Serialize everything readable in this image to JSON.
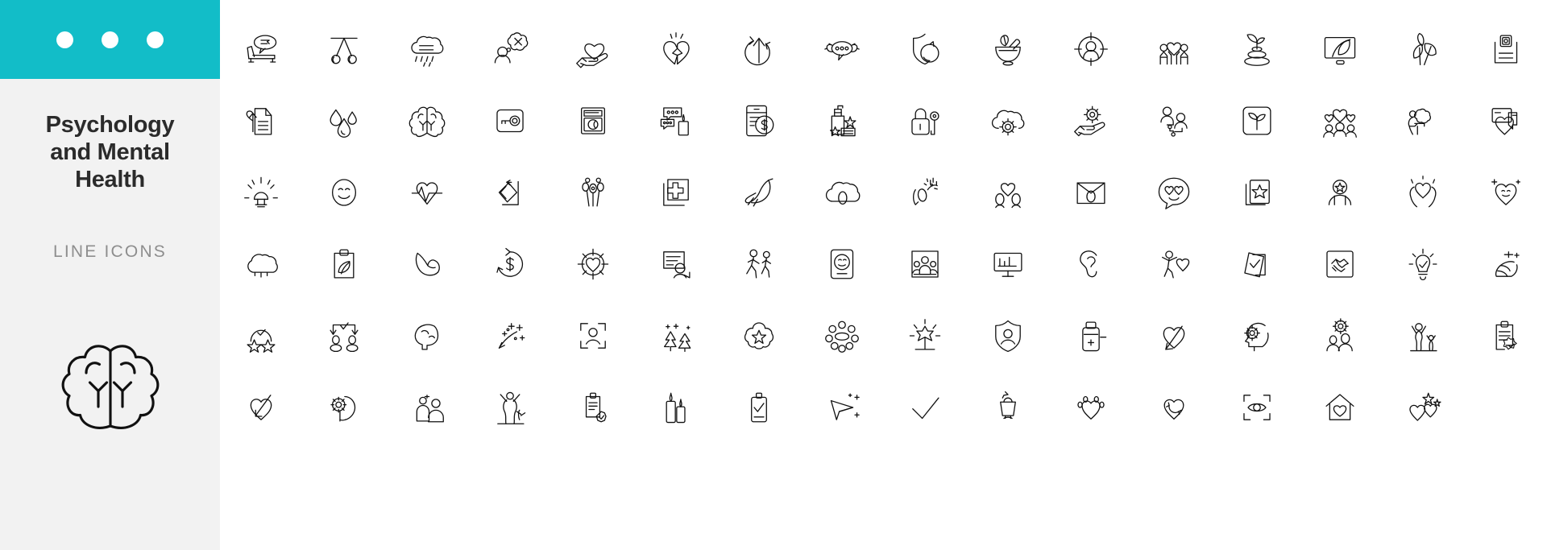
{
  "sidebar": {
    "title": "Psychology and Mental Health",
    "subtitle": "LINE ICONS",
    "accent_color": "#12bdc8",
    "background_color": "#f2f2f2",
    "topbar_dots": [
      "dot-1",
      "dot-2",
      "dot-3"
    ],
    "logo_icon": "brain-icon"
  },
  "grid": {
    "columns": 16,
    "rows": 6,
    "stroke_color": "#111111",
    "background_color": "#ffffff",
    "icons": [
      "therapy-couch-speech-bubble-icon",
      "pendulum-hypnosis-icon",
      "rain-cloud-icon",
      "person-negative-thought-bubble-icon",
      "hand-holding-heart-icon",
      "broken-heart-icon",
      "recovery-arrow-up-icon",
      "speech-bubble-strong-arms-icon",
      "shield-refresh-icon",
      "mortar-pestle-herb-icon",
      "person-target-icon",
      "two-people-heart-icon",
      "zen-stones-plant-icon",
      "monitor-leaf-icon",
      "leaves-icon",
      "medical-record-photo-icon",
      "heart-document-upload-icon",
      "water-drops-icon",
      "brain-icon",
      "key-card-icon",
      "washing-machine-icon",
      "chat-bubbles-candle-icon",
      "mobile-payment-icon",
      "soap-dispenser-stars-icon",
      "padlock-key-icon",
      "cloud-gear-icon",
      "hand-holding-gear-icon",
      "people-network-icon",
      "first-aid-plant-icon",
      "group-hearts-icon",
      "person-desk-thought-cloud-icon",
      "chat-heart-icon",
      "sunrise-light-icon",
      "smiley-face-icon",
      "heartbeat-pulse-icon",
      "flip-card-icon",
      "dandelion-icon",
      "hospital-cross-photo-icon",
      "dove-peace-icon",
      "cloud-egg-icon",
      "person-stretching-sparkle-icon",
      "two-hearts-people-icon",
      "envelope-letter-icon",
      "heart-eyes-chat-icon",
      "star-card-icon",
      "person-star-badge-icon",
      "hands-heart-raise-icon",
      "heart-smiling-sparkle-icon",
      "cloud-thought-icon",
      "clipboard-leaf-icon",
      "flexed-arm-muscle-icon",
      "money-refresh-icon",
      "heart-target-icon",
      "document-person-search-icon",
      "walking-people-icon",
      "smiley-phone-icon",
      "group-presentation-icon",
      "presentation-board-icon",
      "ear-listen-icon",
      "person-heart-celebrate-icon",
      "checked-cards-icon",
      "handshake-frame-icon",
      "lightbulb-check-icon",
      "hand-sparkle-icon",
      "award-stars-check-icon",
      "choice-decision-icon",
      "brain-side-icon",
      "fireworks-sparkle-icon",
      "face-scan-icon",
      "trees-sparkle-icon",
      "flower-star-icon",
      "circle-dots-bloom-icon",
      "sunburst-gear-icon",
      "shield-id-card-icon",
      "pill-bottle-icon",
      "heart-arrow-growth-icon",
      "head-gear-thinking-icon",
      "two-people-gear-icon",
      "person-celebrating-plants-icon",
      "clipboard-badge-icon",
      "candles-icon",
      "briefcase-check-icon",
      "paper-plane-sparkle-icon",
      "check-mark-icon",
      "trophy-icon",
      "paw-heart-icon",
      "recycle-heart-icon",
      "eye-scan-icon",
      "home-heart-icon",
      "hearts-stars-icon"
    ]
  }
}
